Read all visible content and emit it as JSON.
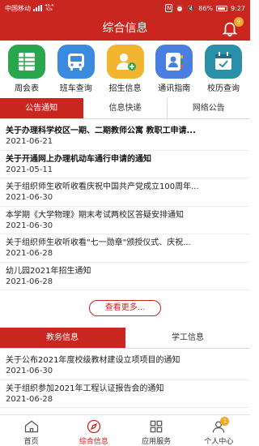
{
  "status_bar": {
    "carrier": "中国移动",
    "net_speed": "46.4\nK/s",
    "battery": "86%",
    "time": "9:27"
  },
  "header": {
    "title": "综合信息",
    "notification_count": "9"
  },
  "quick_links": [
    {
      "label": "周会表",
      "icon": "spreadsheet-icon"
    },
    {
      "label": "班车查询",
      "icon": "bus-icon"
    },
    {
      "label": "招生信息",
      "icon": "enrollment-icon"
    },
    {
      "label": "通讯指南",
      "icon": "contacts-icon"
    },
    {
      "label": "校历查询",
      "icon": "calendar-icon"
    }
  ],
  "tabs_top": [
    "公告通知",
    "信息快递",
    "网络公告"
  ],
  "notices": [
    {
      "title": "关于办理科学校区一期、二期教师公寓 教职工申请...",
      "date": "2021-06-21"
    },
    {
      "title": "关于开通网上办理机动车通行申请的通知",
      "date": "2021-05-11"
    },
    {
      "title": "关于组织师生收听收看庆祝中国共产党成立100周年...",
      "date": "2021-06-30"
    },
    {
      "title": "本学期《大学物理》期末考试两校区答疑安排通知",
      "date": "2021-06-30"
    },
    {
      "title": "关于组织师生收听收看\"七一勋章\"颁授仪式、庆祝...",
      "date": "2021-06-28"
    },
    {
      "title": "幼儿园2021年招生通知",
      "date": "2021-06-28"
    }
  ],
  "more_label": "查看更多...",
  "tabs_bottom": [
    "教务信息",
    "学工信息"
  ],
  "academic": [
    {
      "title": "关于公布2021年度校级教材建设立项项目的通知",
      "date": "2021-06-30"
    },
    {
      "title": "关于组织参加2021年工程认证报告会的通知",
      "date": "2021-06-28"
    }
  ],
  "bottom_nav": [
    {
      "label": "首页"
    },
    {
      "label": "综合信息"
    },
    {
      "label": "应用服务"
    },
    {
      "label": "个人中心",
      "badge": "1"
    }
  ],
  "colors": {
    "brand": "#c8261f",
    "badge": "#f5a623"
  }
}
